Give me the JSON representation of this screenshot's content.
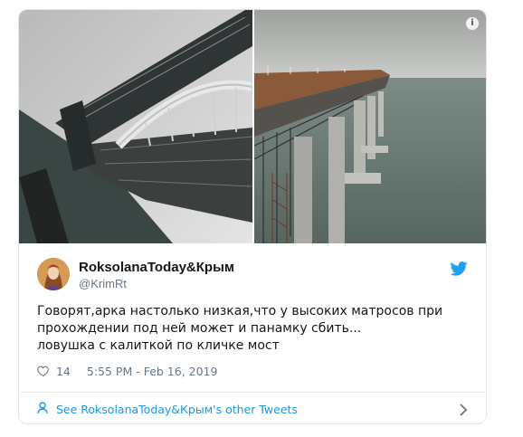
{
  "tweet": {
    "display_name": "RoksolanaToday&Крым",
    "handle": "@KrimRt",
    "text": "Говорят,арка настолько низкая,что у высоких матросов при\nпрохождении под ней может и панамку сбить...\nловушка с калиткой по кличке мост",
    "likes": "14",
    "timestamp": "5:55 PM - Feb 16, 2019",
    "other_tweets_label": "See RoksolanaToday&Крым's other Tweets"
  },
  "media": {
    "info_icon": "info-icon",
    "photos": [
      "bridge-arch-photo",
      "bridge-pillars-photo"
    ]
  },
  "colors": {
    "accent": "#1b95e0",
    "text": "#14171a",
    "secondary": "#657786",
    "border": "#e1e8ed"
  }
}
